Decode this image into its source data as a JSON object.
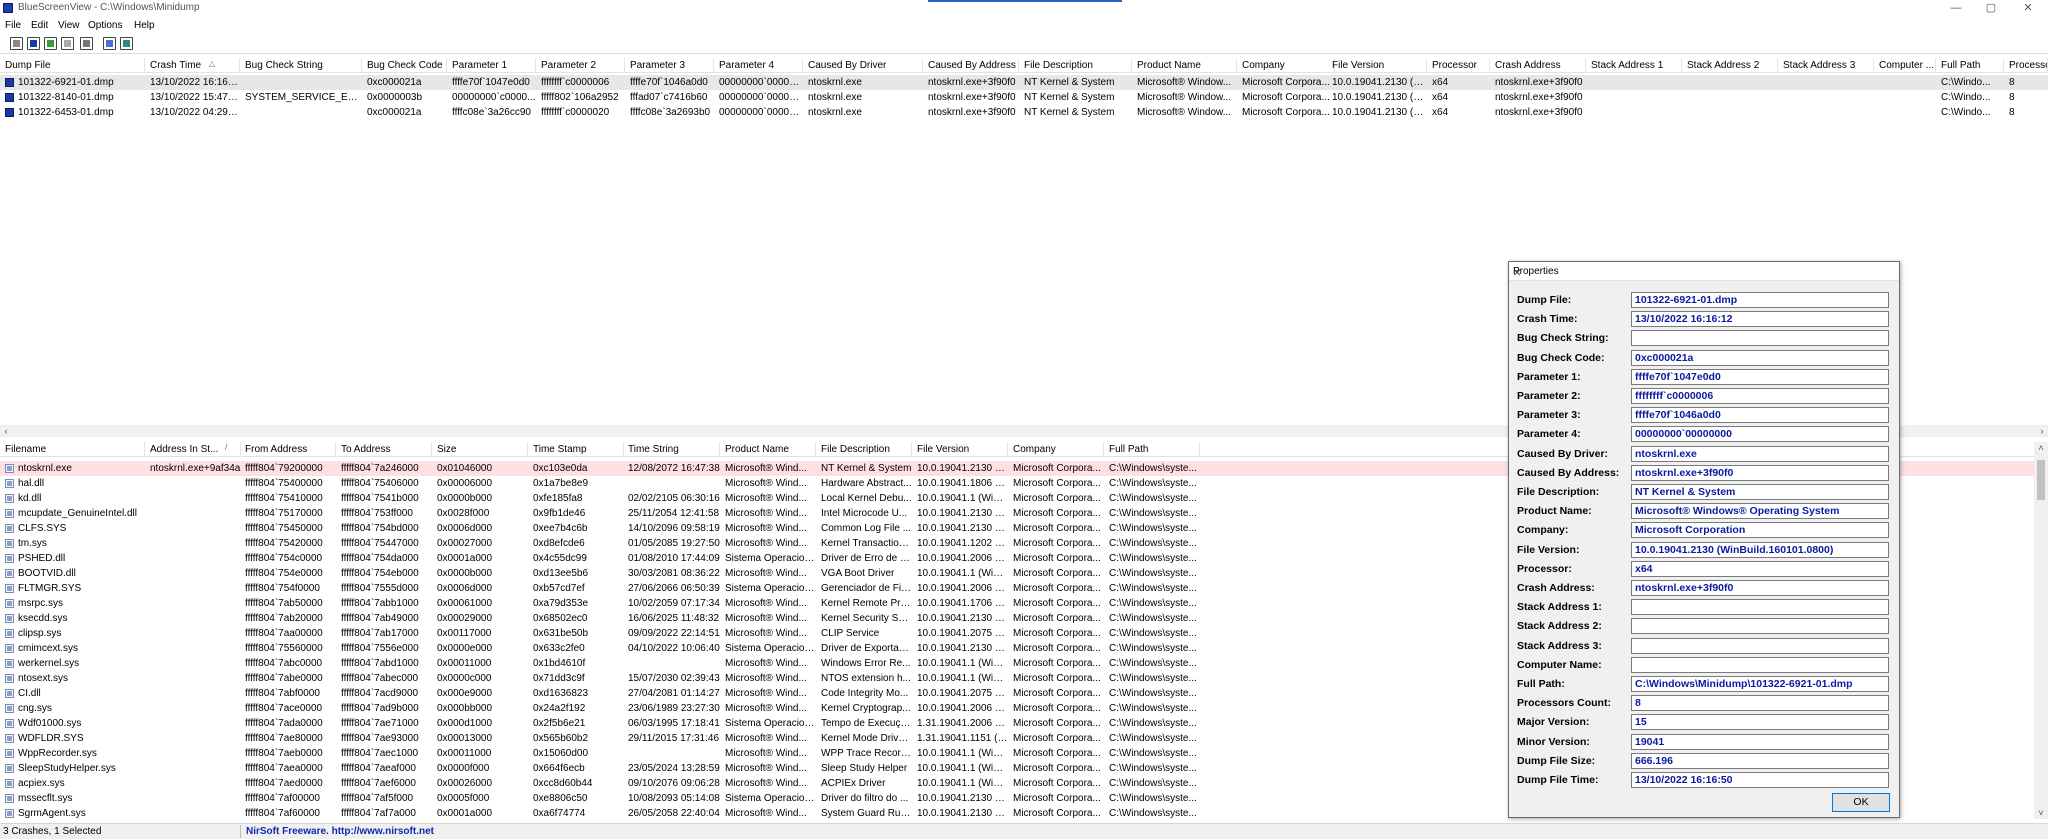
{
  "window": {
    "title": "BlueScreenView  -  C:\\Windows\\Minidump",
    "controls": [
      "—",
      "▢",
      "✕"
    ]
  },
  "menu": [
    "File",
    "Edit",
    "View",
    "Options",
    "Help"
  ],
  "toolbar": [
    {
      "icon": "properties-icon"
    },
    {
      "icon": "save-icon"
    },
    {
      "icon": "html-report-icon"
    },
    {
      "icon": "copy-icon"
    },
    {
      "icon": "advanced-options-icon"
    },
    {
      "icon": "find-icon"
    },
    {
      "icon": "exit-icon"
    }
  ],
  "upper": {
    "sort_indicator": "△",
    "columns": [
      "Dump File",
      "Crash Time",
      "Bug Check String",
      "Bug Check Code",
      "Parameter 1",
      "Parameter 2",
      "Parameter 3",
      "Parameter 4",
      "Caused By Driver",
      "Caused By Address",
      "File Description",
      "Product Name",
      "Company",
      "File Version",
      "Processor",
      "Crash Address",
      "Stack Address 1",
      "Stack Address 2",
      "Stack Address 3",
      "Computer ...",
      "Full Path",
      "Processor..."
    ],
    "rows": [
      [
        "101322-6921-01.dmp",
        "13/10/2022 16:16:12",
        "",
        "0xc000021a",
        "ffffe70f`1047e0d0",
        "ffffffff`c0000006",
        "ffffe70f`1046a0d0",
        "00000000`000000...",
        "ntoskrnl.exe",
        "ntoskrnl.exe+3f90f0",
        "NT Kernel & System",
        "Microsoft® Window...",
        "Microsoft Corpora...",
        "10.0.19041.2130 (W...",
        "x64",
        "ntoskrnl.exe+3f90f0",
        "",
        "",
        "",
        "",
        "C:\\Windo...",
        "8"
      ],
      [
        "101322-8140-01.dmp",
        "13/10/2022 15:47:57",
        "SYSTEM_SERVICE_EXCEP...",
        "0x0000003b",
        "00000000`c0000...",
        "fffff802`106a2952",
        "fffad07`c7416b60",
        "00000000`000000...",
        "ntoskrnl.exe",
        "ntoskrnl.exe+3f90f0",
        "NT Kernel & System",
        "Microsoft® Window...",
        "Microsoft Corpora...",
        "10.0.19041.2130 (W...",
        "x64",
        "ntoskrnl.exe+3f90f0",
        "",
        "",
        "",
        "",
        "C:\\Windo...",
        "8"
      ],
      [
        "101322-6453-01.dmp",
        "13/10/2022 04:29:37",
        "",
        "0xc000021a",
        "ffffc08e`3a26cc90",
        "ffffffff`c0000020",
        "ffffc08e`3a2693b0",
        "00000000`000000...",
        "ntoskrnl.exe",
        "ntoskrnl.exe+3f90f0",
        "NT Kernel & System",
        "Microsoft® Window...",
        "Microsoft Corpora...",
        "10.0.19041.2130 (W...",
        "x64",
        "ntoskrnl.exe+3f90f0",
        "",
        "",
        "",
        "",
        "C:\\Windo...",
        "8"
      ]
    ]
  },
  "lower": {
    "sort_indicator": "/",
    "columns": [
      "Filename",
      "Address In St...",
      "From Address",
      "To Address",
      "Size",
      "Time Stamp",
      "Time String",
      "Product Name",
      "File Description",
      "File Version",
      "Company",
      "Full Path"
    ],
    "rows": [
      [
        "ntoskrnl.exe",
        "ntoskrnl.exe+9af34a",
        "fffff804`79200000",
        "fffff804`7a246000",
        "0x01046000",
        "0xc103e0da",
        "12/08/2072 16:47:38",
        "Microsoft® Wind...",
        "NT Kernel & System",
        "10.0.19041.2130 (W...",
        "Microsoft Corpora...",
        "C:\\Windows\\syste..."
      ],
      [
        "hal.dll",
        "",
        "fffff804`75400000",
        "fffff804`75406000",
        "0x00006000",
        "0x1a7be8e9",
        "",
        "Microsoft® Wind...",
        "Hardware Abstract...",
        "10.0.19041.1806 (W...",
        "Microsoft Corpora...",
        "C:\\Windows\\syste..."
      ],
      [
        "kd.dll",
        "",
        "fffff804`75410000",
        "fffff804`7541b000",
        "0x0000b000",
        "0xfe185fa8",
        "02/02/2105 06:30:16",
        "Microsoft® Wind...",
        "Local Kernel Debu...",
        "10.0.19041.1 (WinB...",
        "Microsoft Corpora...",
        "C:\\Windows\\syste..."
      ],
      [
        "mcupdate_GenuineIntel.dll",
        "",
        "fffff804`75170000",
        "fffff804`753ff000",
        "0x0028f000",
        "0x9fb1de46",
        "25/11/2054 12:41:58",
        "Microsoft® Wind...",
        "Intel Microcode U...",
        "10.0.19041.2130 (W...",
        "Microsoft Corpora...",
        "C:\\Windows\\syste..."
      ],
      [
        "CLFS.SYS",
        "",
        "fffff804`75450000",
        "fffff804`754bd000",
        "0x0006d000",
        "0xee7b4c6b",
        "14/10/2096 09:58:19",
        "Microsoft® Wind...",
        "Common Log File ...",
        "10.0.19041.2130 (W...",
        "Microsoft Corpora...",
        "C:\\Windows\\syste..."
      ],
      [
        "tm.sys",
        "",
        "fffff804`75420000",
        "fffff804`75447000",
        "0x00027000",
        "0xd8efcde6",
        "01/05/2085 19:27:50",
        "Microsoft® Wind...",
        "Kernel Transaction ...",
        "10.0.19041.1202 (W...",
        "Microsoft Corpora...",
        "C:\\Windows\\syste..."
      ],
      [
        "PSHED.dll",
        "",
        "fffff804`754c0000",
        "fffff804`754da000",
        "0x0001a000",
        "0x4c55dc99",
        "01/08/2010 17:44:09",
        "Sistema Operacion...",
        "Driver de Erro de H...",
        "10.0.19041.2006 (W...",
        "Microsoft Corpora...",
        "C:\\Windows\\syste..."
      ],
      [
        "BOOTVID.dll",
        "",
        "fffff804`754e0000",
        "fffff804`754eb000",
        "0x0000b000",
        "0xd13ee5b6",
        "30/03/2081 08:36:22",
        "Microsoft® Wind...",
        "VGA Boot Driver",
        "10.0.19041.1 (WinB...",
        "Microsoft Corpora...",
        "C:\\Windows\\syste..."
      ],
      [
        "FLTMGR.SYS",
        "",
        "fffff804`754f0000",
        "fffff804`7555d000",
        "0x0006d000",
        "0xb57cd7ef",
        "27/06/2066 06:50:39",
        "Sistema Operacion...",
        "Gerenciador de Filt...",
        "10.0.19041.2006 (W...",
        "Microsoft Corpora...",
        "C:\\Windows\\syste..."
      ],
      [
        "msrpc.sys",
        "",
        "fffff804`7ab50000",
        "fffff804`7abb1000",
        "0x00061000",
        "0xa79d353e",
        "10/02/2059 07:17:34",
        "Microsoft® Wind...",
        "Kernel Remote Pro...",
        "10.0.19041.1706 (W...",
        "Microsoft Corpora...",
        "C:\\Windows\\syste..."
      ],
      [
        "ksecdd.sys",
        "",
        "fffff804`7ab20000",
        "fffff804`7ab49000",
        "0x00029000",
        "0x68502ec0",
        "16/06/2025 11:48:32",
        "Microsoft® Wind...",
        "Kernel Security Su...",
        "10.0.19041.2130 (W...",
        "Microsoft Corpora...",
        "C:\\Windows\\syste..."
      ],
      [
        "clipsp.sys",
        "",
        "fffff804`7aa00000",
        "fffff804`7ab17000",
        "0x00117000",
        "0x631be50b",
        "09/09/2022 22:14:51",
        "Microsoft® Wind...",
        "CLIP Service",
        "10.0.19041.2075 (W...",
        "Microsoft Corpora...",
        "C:\\Windows\\syste..."
      ],
      [
        "cmimcext.sys",
        "",
        "fffff804`75560000",
        "fffff804`7556e000",
        "0x0000e000",
        "0x633c2fe0",
        "04/10/2022 10:06:40",
        "Sistema Operacion...",
        "Driver de Exportaç...",
        "10.0.19041.2130 (W...",
        "Microsoft Corpora...",
        "C:\\Windows\\syste..."
      ],
      [
        "werkernel.sys",
        "",
        "fffff804`7abc0000",
        "fffff804`7abd1000",
        "0x00011000",
        "0x1bd4610f",
        "",
        "Microsoft® Wind...",
        "Windows Error Re...",
        "10.0.19041.1 (WinB...",
        "Microsoft Corpora...",
        "C:\\Windows\\syste..."
      ],
      [
        "ntosext.sys",
        "",
        "fffff804`7abe0000",
        "fffff804`7abec000",
        "0x0000c000",
        "0x71dd3c9f",
        "15/07/2030 02:39:43",
        "Microsoft® Wind...",
        "NTOS extension h...",
        "10.0.19041.1 (WinB...",
        "Microsoft Corpora...",
        "C:\\Windows\\syste..."
      ],
      [
        "CI.dll",
        "",
        "fffff804`7abf0000",
        "fffff804`7acd9000",
        "0x000e9000",
        "0xd1636823",
        "27/04/2081 01:14:27",
        "Microsoft® Wind...",
        "Code Integrity Mo...",
        "10.0.19041.2075 (W...",
        "Microsoft Corpora...",
        "C:\\Windows\\syste..."
      ],
      [
        "cng.sys",
        "",
        "fffff804`7ace0000",
        "fffff804`7ad9b000",
        "0x000bb000",
        "0x24a2f192",
        "23/06/1989 23:27:30",
        "Microsoft® Wind...",
        "Kernel Cryptograp...",
        "10.0.19041.2006 (W...",
        "Microsoft Corpora...",
        "C:\\Windows\\syste..."
      ],
      [
        "Wdf01000.sys",
        "",
        "fffff804`7ada0000",
        "fffff804`7ae71000",
        "0x000d1000",
        "0x2f5b6e21",
        "06/03/1995 17:18:41",
        "Sistema Operacion...",
        "Tempo de Execuçã...",
        "1.31.19041.2006 (W...",
        "Microsoft Corpora...",
        "C:\\Windows\\syste..."
      ],
      [
        "WDFLDR.SYS",
        "",
        "fffff804`7ae80000",
        "fffff804`7ae93000",
        "0x00013000",
        "0x565b60b2",
        "29/11/2015 17:31:46",
        "Microsoft® Wind...",
        "Kernel Mode Drive...",
        "1.31.19041.1151 (W...",
        "Microsoft Corpora...",
        "C:\\Windows\\syste..."
      ],
      [
        "WppRecorder.sys",
        "",
        "fffff804`7aeb0000",
        "fffff804`7aec1000",
        "0x00011000",
        "0x15060d00",
        "",
        "Microsoft® Wind...",
        "WPP Trace Recorder",
        "10.0.19041.1 (WinB...",
        "Microsoft Corpora...",
        "C:\\Windows\\syste..."
      ],
      [
        "SleepStudyHelper.sys",
        "",
        "fffff804`7aea0000",
        "fffff804`7aeaf000",
        "0x0000f000",
        "0x664f6ecb",
        "23/05/2024 13:28:59",
        "Microsoft® Wind...",
        "Sleep Study Helper",
        "10.0.19041.1 (WinB...",
        "Microsoft Corpora...",
        "C:\\Windows\\syste..."
      ],
      [
        "acpiex.sys",
        "",
        "fffff804`7aed0000",
        "fffff804`7aef6000",
        "0x00026000",
        "0xcc8d60b44",
        "09/10/2076 09:06:28",
        "Microsoft® Wind...",
        "ACPIEx Driver",
        "10.0.19041.1 (WinB...",
        "Microsoft Corpora...",
        "C:\\Windows\\syste..."
      ],
      [
        "mssecflt.sys",
        "",
        "fffff804`7af00000",
        "fffff804`7af5f000",
        "0x0005f000",
        "0xe8806c50",
        "10/08/2093 05:14:08",
        "Sistema Operacion...",
        "Driver do filtro do ...",
        "10.0.19041.2130 (W...",
        "Microsoft Corpora...",
        "C:\\Windows\\syste..."
      ],
      [
        "SgrmAgent.sys",
        "",
        "fffff804`7af60000",
        "fffff804`7af7a000",
        "0x0001a000",
        "0xa6f74774",
        "26/05/2058 22:40:04",
        "Microsoft® Wind...",
        "System Guard Run...",
        "10.0.19041.2130 (W...",
        "Microsoft Corpora...",
        "C:\\Windows\\syste..."
      ]
    ]
  },
  "status": {
    "left": "3 Crashes, 1 Selected",
    "right": "NirSoft Freeware.  http://www.nirsoft.net"
  },
  "properties": {
    "title": "Properties",
    "ok": "OK",
    "rows": [
      {
        "label": "Dump File:",
        "value": "101322-6921-01.dmp"
      },
      {
        "label": "Crash Time:",
        "value": "13/10/2022 16:16:12"
      },
      {
        "label": "Bug Check String:",
        "value": ""
      },
      {
        "label": "Bug Check Code:",
        "value": "0xc000021a"
      },
      {
        "label": "Parameter 1:",
        "value": "ffffe70f`1047e0d0"
      },
      {
        "label": "Parameter 2:",
        "value": "ffffffff`c0000006"
      },
      {
        "label": "Parameter 3:",
        "value": "ffffe70f`1046a0d0"
      },
      {
        "label": "Parameter 4:",
        "value": "00000000`00000000"
      },
      {
        "label": "Caused By Driver:",
        "value": "ntoskrnl.exe"
      },
      {
        "label": "Caused By Address:",
        "value": "ntoskrnl.exe+3f90f0"
      },
      {
        "label": "File Description:",
        "value": "NT Kernel & System"
      },
      {
        "label": "Product Name:",
        "value": "Microsoft® Windows® Operating System"
      },
      {
        "label": "Company:",
        "value": "Microsoft Corporation"
      },
      {
        "label": "File Version:",
        "value": "10.0.19041.2130 (WinBuild.160101.0800)"
      },
      {
        "label": "Processor:",
        "value": "x64"
      },
      {
        "label": "Crash Address:",
        "value": "ntoskrnl.exe+3f90f0"
      },
      {
        "label": "Stack Address 1:",
        "value": ""
      },
      {
        "label": "Stack Address 2:",
        "value": ""
      },
      {
        "label": "Stack Address 3:",
        "value": ""
      },
      {
        "label": "Computer Name:",
        "value": ""
      },
      {
        "label": "Full Path:",
        "value": "C:\\Windows\\Minidump\\101322-6921-01.dmp"
      },
      {
        "label": "Processors Count:",
        "value": "8"
      },
      {
        "label": "Major Version:",
        "value": "15"
      },
      {
        "label": "Minor Version:",
        "value": "19041"
      },
      {
        "label": "Dump File Size:",
        "value": "666.196"
      },
      {
        "label": "Dump File Time:",
        "value": "13/10/2022 16:16:50"
      }
    ]
  }
}
